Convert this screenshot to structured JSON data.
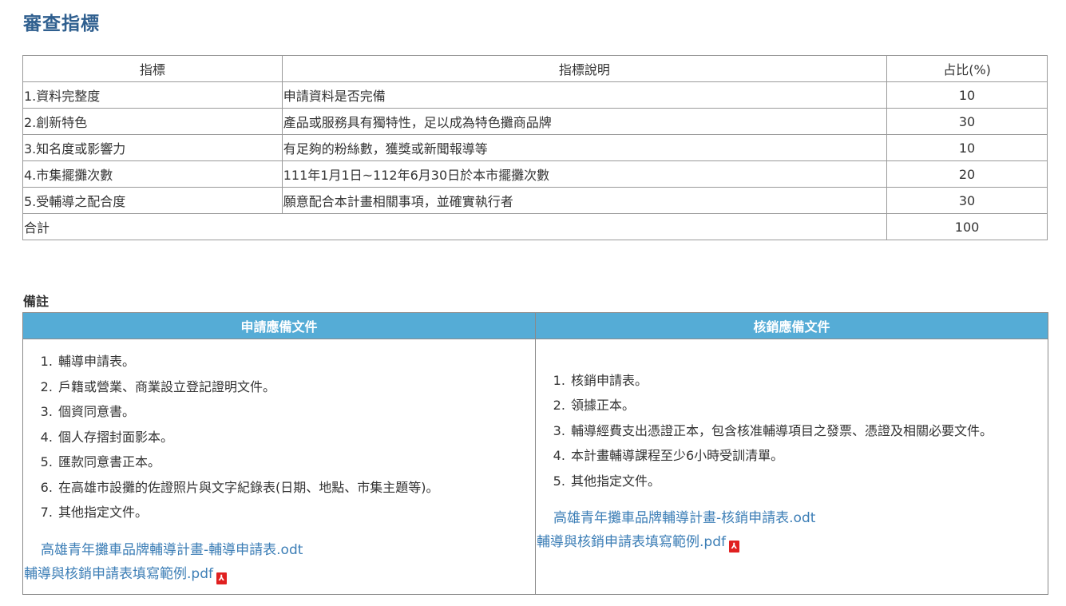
{
  "page_title": "審查指標",
  "criteria_table": {
    "headers": [
      "指標",
      "指標說明",
      "占比(%)"
    ],
    "rows": [
      {
        "indicator": "1.資料完整度",
        "description": "申請資料是否完備",
        "ratio": "10"
      },
      {
        "indicator": "2.創新特色",
        "description": "產品或服務具有獨特性，足以成為特色攤商品牌",
        "ratio": "30"
      },
      {
        "indicator": "3.知名度或影響力",
        "description": "有足夠的粉絲數，獲獎或新聞報導等",
        "ratio": "10"
      },
      {
        "indicator": "4.市集擺攤次數",
        "description": "111年1月1日~112年6月30日於本市擺攤次數",
        "ratio": "20"
      },
      {
        "indicator": "5.受輔導之配合度",
        "description": "願意配合本計畫相關事項，並確實執行者",
        "ratio": "30"
      }
    ],
    "total_label": "合計",
    "total_value": "100"
  },
  "remarks": {
    "title": "備註",
    "application": {
      "header": "申請應備文件",
      "items": [
        "輔導申請表。",
        "戶籍或營業、商業設立登記證明文件。",
        "個資同意書。",
        "個人存摺封面影本。",
        "匯款同意書正本。",
        "在高雄市設攤的佐證照片與文字紀錄表(日期、地點、市集主題等)。",
        "其他指定文件。"
      ],
      "link_form": "高雄青年攤車品牌輔導計畫-輔導申請表.odt",
      "link_example": "輔導與核銷申請表填寫範例.pdf"
    },
    "verification": {
      "header": "核銷應備文件",
      "items": [
        "核銷申請表。",
        "領據正本。",
        "輔導經費支出憑證正本，包含核准輔導項目之發票、憑證及相關必要文件。",
        "本計畫輔導課程至少6小時受訓清單。",
        "其他指定文件。"
      ],
      "link_form": "高雄青年攤車品牌輔導計畫-核銷申請表.odt",
      "link_example": "輔導與核銷申請表填寫範例.pdf"
    }
  }
}
